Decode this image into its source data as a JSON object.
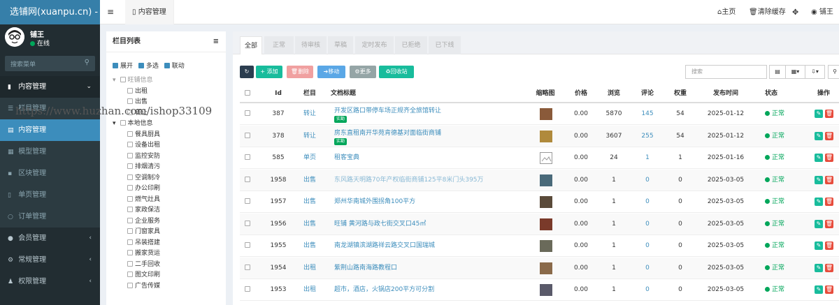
{
  "app": {
    "logo": "选铺网(xuanpu.cn) -",
    "user_name": "铺王",
    "user_status": "在线",
    "search_placeholder": "搜索菜单"
  },
  "watermark": "https://www.huzhan.com/ishop33109",
  "sidebar": {
    "items": [
      {
        "label": "内容管理",
        "icon": "file-icon",
        "arrow": "⌄"
      },
      {
        "label": "栏目管理",
        "icon": "list-icon",
        "arrow": ""
      },
      {
        "label": "内容管理",
        "icon": "file-text-icon",
        "arrow": ""
      },
      {
        "label": "模型管理",
        "icon": "grid-icon",
        "arrow": ""
      },
      {
        "label": "区块管理",
        "icon": "blocks-icon",
        "arrow": ""
      },
      {
        "label": "单页管理",
        "icon": "page-icon",
        "arrow": ""
      },
      {
        "label": "订单管理",
        "icon": "circle-icon",
        "arrow": ""
      },
      {
        "label": "会员管理",
        "icon": "user-icon",
        "arrow": "‹"
      },
      {
        "label": "常规管理",
        "icon": "cogs-icon",
        "arrow": "‹"
      },
      {
        "label": "权限管理",
        "icon": "group-icon",
        "arrow": "‹"
      }
    ]
  },
  "header": {
    "tab_label": "内容管理",
    "home": "主页",
    "clear_cache": "清除缓存",
    "user_short": "铺王"
  },
  "category_panel": {
    "title": "栏目列表",
    "opt_expand": "展开",
    "opt_multi": "多选",
    "opt_link": "联动",
    "tree": [
      {
        "label": "旺铺信息",
        "level": 0,
        "dim": true
      },
      {
        "label": "出租",
        "level": 1
      },
      {
        "label": "出售",
        "level": 1
      },
      {
        "label": "转让",
        "level": 1
      },
      {
        "label": "本地信息",
        "level": 0
      },
      {
        "label": "餐具厨具",
        "level": 1
      },
      {
        "label": "设备出租",
        "level": 1
      },
      {
        "label": "监控安防",
        "level": 1
      },
      {
        "label": "排烟清污",
        "level": 1
      },
      {
        "label": "空调制冷",
        "level": 1
      },
      {
        "label": "办公印刷",
        "level": 1
      },
      {
        "label": "燃气灶具",
        "level": 1
      },
      {
        "label": "家政保洁",
        "level": 1
      },
      {
        "label": "企业服务",
        "level": 1
      },
      {
        "label": "门窗家具",
        "level": 1
      },
      {
        "label": "吊装搭建",
        "level": 1
      },
      {
        "label": "搬家货运",
        "level": 1
      },
      {
        "label": "二手回收",
        "level": 1
      },
      {
        "label": "图文印刷",
        "level": 1
      },
      {
        "label": "广告传媒",
        "level": 1
      }
    ]
  },
  "main": {
    "tabs": [
      "全部",
      "正常",
      "待审核",
      "草稿",
      "定时发布",
      "已拒绝",
      "已下线"
    ],
    "toolbar": {
      "add": "添加",
      "delete": "删除",
      "move": "移动",
      "more": "更多",
      "recycle": "回收站",
      "search_placeholder": "搜索"
    },
    "columns": [
      "Id",
      "栏目",
      "文档标题",
      "缩略图",
      "价格",
      "浏览",
      "评论",
      "权重",
      "发布时间",
      "状态",
      "操作"
    ],
    "rows": [
      {
        "id": "387",
        "cat": "转让",
        "title": "开发区路口带停车场正规齐全旅馆转让",
        "badge": "实勘",
        "thumb": "#8a5a3a",
        "price": "0.00",
        "views": "5870",
        "comments": "145",
        "weight": "54",
        "date": "2025-01-12",
        "status": "正常",
        "faded": false
      },
      {
        "id": "378",
        "cat": "转让",
        "title": "房东直租南开华苑肯德基对面临街商铺",
        "badge": "实勘",
        "thumb": "#b08a3c",
        "price": "0.00",
        "views": "3607",
        "comments": "255",
        "weight": "54",
        "date": "2025-01-12",
        "status": "正常",
        "faded": false
      },
      {
        "id": "585",
        "cat": "单页",
        "title": "租客宝典",
        "badge": "",
        "thumb": "",
        "price": "0.00",
        "views": "24",
        "comments": "1",
        "weight": "1",
        "date": "2025-01-16",
        "status": "正常",
        "faded": false
      },
      {
        "id": "1958",
        "cat": "出售",
        "title": "东风路天明路70年产权临街商铺125平8米门头395万",
        "badge": "",
        "thumb": "#4a6a7a",
        "price": "0.00",
        "views": "1",
        "comments": "0",
        "weight": "0",
        "date": "2025-03-05",
        "status": "正常",
        "faded": true
      },
      {
        "id": "1957",
        "cat": "出售",
        "title": "郑州华南城外围拐角100平方",
        "badge": "",
        "thumb": "#5a4a3a",
        "price": "0.00",
        "views": "1",
        "comments": "0",
        "weight": "0",
        "date": "2025-03-05",
        "status": "正常",
        "faded": false
      },
      {
        "id": "1956",
        "cat": "出售",
        "title": "旺铺 黄河路与政七街交叉口45㎡",
        "badge": "",
        "thumb": "#7a3a2a",
        "price": "0.00",
        "views": "1",
        "comments": "0",
        "weight": "0",
        "date": "2025-03-05",
        "status": "正常",
        "faded": false
      },
      {
        "id": "1955",
        "cat": "出售",
        "title": "南龙湖镇滨湖路祥云路交叉口国瑞城",
        "badge": "",
        "thumb": "#6a6a5a",
        "price": "0.00",
        "views": "1",
        "comments": "0",
        "weight": "0",
        "date": "2025-03-05",
        "status": "正常",
        "faded": false
      },
      {
        "id": "1954",
        "cat": "出租",
        "title": "紫荆山路南海路教程口",
        "badge": "",
        "thumb": "#8a6a4a",
        "price": "0.00",
        "views": "1",
        "comments": "0",
        "weight": "0",
        "date": "2025-03-05",
        "status": "正常",
        "faded": false
      },
      {
        "id": "1953",
        "cat": "出租",
        "title": "超市，酒店，火锅店200平方可分割",
        "badge": "",
        "thumb": "#5a5a6a",
        "price": "0.00",
        "views": "1",
        "comments": "0",
        "weight": "0",
        "date": "2025-03-05",
        "status": "正常",
        "faded": false
      }
    ]
  },
  "colors": {
    "sidebar_bg": "#222d32",
    "logo_bg": "#367fa9",
    "primary": "#3c8dbc",
    "success": "#00a65a",
    "danger": "#f56954",
    "info": "#5aa7e6"
  }
}
